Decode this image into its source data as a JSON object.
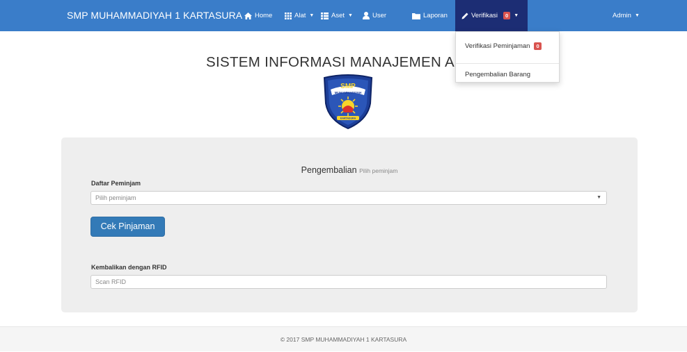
{
  "navbar": {
    "brand": "SMP MUHAMMADIYAH 1 KARTASURA",
    "items": [
      {
        "label": "Home",
        "icon": "home-icon"
      },
      {
        "label": "Alat",
        "icon": "grid-icon",
        "dropdown": true
      },
      {
        "label": "Aset",
        "icon": "list-icon",
        "dropdown": true
      },
      {
        "label": "User",
        "icon": "user-icon"
      },
      {
        "label": "Laporan",
        "icon": "folder-icon"
      },
      {
        "label": "Verifikasi",
        "icon": "pencil-icon",
        "badge": "0",
        "dropdown": true,
        "active": true
      }
    ],
    "admin": "Admin",
    "bg_color": "#3a7dc9",
    "active_color": "#1c2d74"
  },
  "dropdown": {
    "items": [
      {
        "label": "Verifikasi Peminjaman",
        "badge": "0"
      },
      {
        "label": "Pengembalian Barang"
      }
    ]
  },
  "page": {
    "title": "SISTEM INFORMASI MANAJEMEN A",
    "logo_text": "SMP MUHAMMADIYAH KARTASURA"
  },
  "panel": {
    "heading": "Pengembalian",
    "subheading": "Pilih peminjam",
    "daftar_label": "Daftar Peminjam",
    "select_value": "Pilih peminjam",
    "check_button": "Cek Pinjaman",
    "rfid_label": "Kembalikan dengan RFID",
    "rfid_placeholder": "Scan RFID"
  },
  "footer": {
    "text": "© 2017 SMP MUHAMMADIYAH 1 KARTASURA"
  }
}
